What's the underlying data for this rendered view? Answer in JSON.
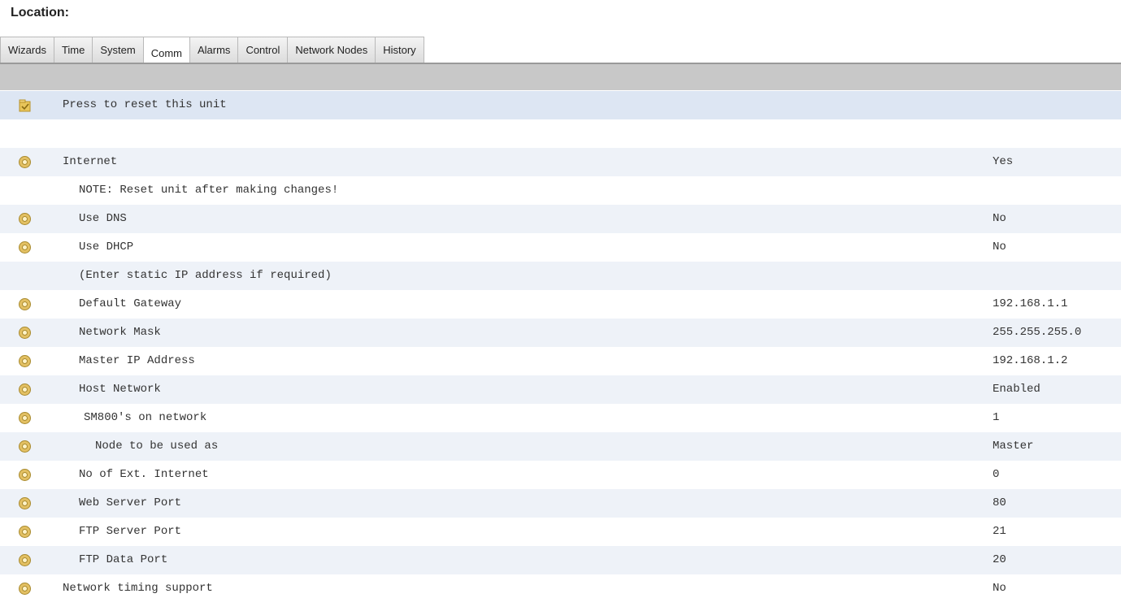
{
  "location_label": "Location:",
  "tabs": [
    "Wizards",
    "Time",
    "System",
    "Comm",
    "Alarms",
    "Control",
    "Network Nodes",
    "History"
  ],
  "active_tab": "Comm",
  "reset_row": {
    "label": "Press to reset this unit",
    "icon": "reset-icon"
  },
  "settings": [
    {
      "label": "Internet",
      "value": "Yes",
      "icon": "gear-icon"
    },
    {
      "label": "NOTE: Reset unit after making changes!",
      "value": "",
      "icon": ""
    },
    {
      "label": "Use DNS",
      "value": "No",
      "icon": "gear-icon"
    },
    {
      "label": "Use DHCP",
      "value": "No",
      "icon": "gear-icon"
    },
    {
      "label": "(Enter static IP address if required)",
      "value": "",
      "icon": ""
    },
    {
      "label": "Default Gateway",
      "value": "192.168.1.1",
      "icon": "gear-icon"
    },
    {
      "label": "Network Mask",
      "value": "255.255.255.0",
      "icon": "gear-icon"
    },
    {
      "label": "Master IP Address",
      "value": "192.168.1.2",
      "icon": "gear-icon"
    },
    {
      "label": "Host Network",
      "value": "Enabled",
      "icon": "gear-icon"
    },
    {
      "label": "SM800's on network",
      "value": "1",
      "icon": "gear-icon"
    },
    {
      "label": "Node to be used as",
      "value": "Master",
      "icon": "gear-icon"
    },
    {
      "label": "No of Ext. Internet",
      "value": "0",
      "icon": "gear-icon"
    },
    {
      "label": "Web Server Port",
      "value": "80",
      "icon": "gear-icon"
    },
    {
      "label": "FTP Server Port",
      "value": "21",
      "icon": "gear-icon"
    },
    {
      "label": "FTP Data Port",
      "value": "20",
      "icon": "gear-icon"
    },
    {
      "label": "Network timing support",
      "value": "No",
      "icon": "gear-icon"
    }
  ]
}
